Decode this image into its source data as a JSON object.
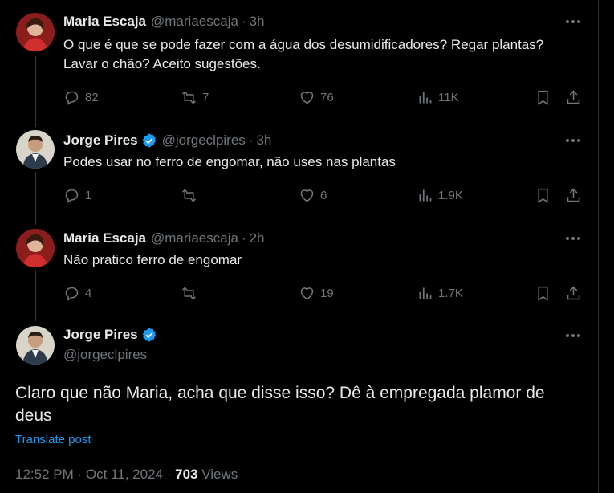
{
  "tweets": [
    {
      "name": "Maria Escaja",
      "handle": "@mariaescaja",
      "sep": "·",
      "time": "3h",
      "verified": false,
      "text": "O que é que se pode fazer com a água dos desumidificadores? Regar plantas? Lavar o chão? Aceito sugestões.",
      "replies": "82",
      "retweets": "7",
      "likes": "76",
      "views": "11K"
    },
    {
      "name": "Jorge Pires",
      "handle": "@jorgeclpires",
      "sep": "·",
      "time": "3h",
      "verified": true,
      "text": "Podes usar no ferro de engomar, não uses nas plantas",
      "replies": "1",
      "retweets": "",
      "likes": "6",
      "views": "1.9K"
    },
    {
      "name": "Maria Escaja",
      "handle": "@mariaescaja",
      "sep": "·",
      "time": "2h",
      "verified": false,
      "text": "Não pratico ferro de engomar",
      "replies": "4",
      "retweets": "",
      "likes": "19",
      "views": "1.7K"
    }
  ],
  "main_tweet": {
    "name": "Jorge Pires",
    "handle": "@jorgeclpires",
    "verified": true,
    "text": "Claro que não Maria, acha que disse isso? Dê à empregada plamor de deus",
    "translate": "Translate post",
    "time": "12:52 PM",
    "sep1": "·",
    "date": "Oct 11, 2024",
    "sep2": "·",
    "views_count": "703",
    "views_label": "Views"
  },
  "colors": {
    "background": "#000000",
    "text": "#e7e9ea",
    "muted": "#71767b",
    "link": "#1d9bf0",
    "verified": "#1d9bf0"
  },
  "icons": [
    "more-icon",
    "reply-icon",
    "retweet-icon",
    "like-icon",
    "views-icon",
    "bookmark-icon",
    "share-icon",
    "verified-badge-icon"
  ]
}
